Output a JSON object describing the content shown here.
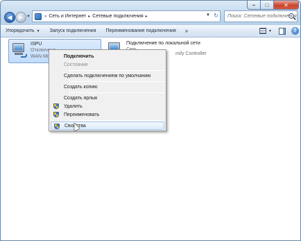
{
  "window": {
    "caption_buttons": {
      "minimize": "–",
      "maximize": "□",
      "close": "✕"
    }
  },
  "nav": {
    "back_glyph": "◀",
    "forward_glyph": "▶",
    "address": {
      "crumbs": [
        "Сеть и Интернет",
        "Сетевые подключения"
      ]
    },
    "search": {
      "placeholder": "Поиск: Сетевые подключения"
    }
  },
  "toolbar": {
    "organize": "Упорядочить",
    "start_connection": "Запуск подключения",
    "rename_connection": "Переименование подключения",
    "more": "»"
  },
  "connections": [
    {
      "name": "ISPU",
      "status": "Отключено",
      "device": "WAN Mini",
      "selected": true
    },
    {
      "name": "Подключение по локальной сети",
      "status": "Сеть",
      "device": "mily Controller",
      "selected": false
    }
  ],
  "context_menu": {
    "items": [
      {
        "label": "Подключить",
        "style": "bold",
        "icon": null
      },
      {
        "label": "Состояние",
        "style": "disabled",
        "icon": null
      },
      {
        "label": "Сделать подключением по умолчанию",
        "style": "normal",
        "icon": null
      },
      {
        "label": "Создать копию",
        "style": "normal",
        "icon": null
      },
      {
        "label": "Создать ярлык",
        "style": "normal",
        "icon": null
      },
      {
        "label": "Удалить",
        "style": "normal",
        "icon": "shield-icon"
      },
      {
        "label": "Переименовать",
        "style": "normal",
        "icon": "shield-icon"
      },
      {
        "label": "Свойства",
        "style": "hover",
        "icon": "shield-icon"
      }
    ]
  }
}
